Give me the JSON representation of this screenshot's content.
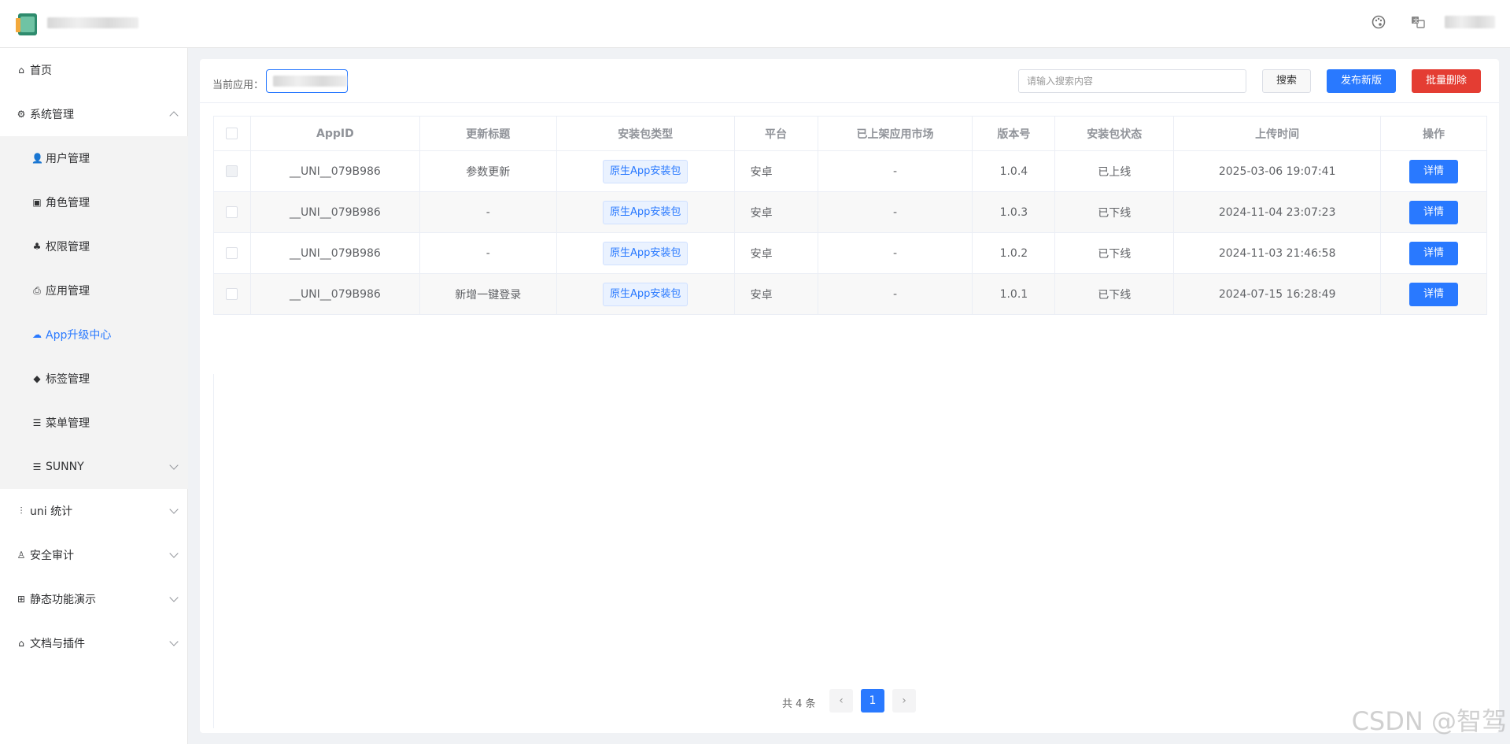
{
  "header": {
    "app_name": "",
    "user_name": "",
    "icons": [
      "palette-icon",
      "translate-icon"
    ]
  },
  "sidebar": {
    "items": [
      {
        "label": "首页",
        "icon": "home-icon"
      },
      {
        "label": "系统管理",
        "icon": "gear-icon",
        "expanded": true
      },
      {
        "label": "用户管理",
        "icon": "user-icon"
      },
      {
        "label": "角色管理",
        "icon": "role-icon"
      },
      {
        "label": "权限管理",
        "icon": "permission-icon"
      },
      {
        "label": "应用管理",
        "icon": "app-icon"
      },
      {
        "label": "App升级中心",
        "icon": "cloud-upload-icon",
        "active": true
      },
      {
        "label": "标签管理",
        "icon": "tag-icon"
      },
      {
        "label": "菜单管理",
        "icon": "list-icon"
      },
      {
        "label": "SUNNY",
        "icon": "list-icon"
      },
      {
        "label": "uni 统计",
        "icon": "stats-icon"
      },
      {
        "label": "安全审计",
        "icon": "audit-icon"
      },
      {
        "label": "静态功能演示",
        "icon": "grid-icon"
      },
      {
        "label": "文档与插件",
        "icon": "plugin-icon"
      }
    ]
  },
  "toolbar": {
    "current_app_label": "当前应用：",
    "current_app_value": "",
    "search_placeholder": "请输入搜索内容",
    "search_button": "搜索",
    "publish_button": "发布新版",
    "batch_delete_button": "批量删除"
  },
  "table": {
    "columns": [
      "AppID",
      "更新标题",
      "安装包类型",
      "平台",
      "已上架应用市场",
      "版本号",
      "安装包状态",
      "上传时间",
      "操作"
    ],
    "rows": [
      {
        "appid": "__UNI__079B986",
        "title": "参数更新",
        "type": "原生App安装包",
        "platform": "安卓",
        "market": "-",
        "version": "1.0.4",
        "status": "已上线",
        "time": "2025-03-06 19:07:41",
        "action": "详情"
      },
      {
        "appid": "__UNI__079B986",
        "title": "-",
        "type": "原生App安装包",
        "platform": "安卓",
        "market": "-",
        "version": "1.0.3",
        "status": "已下线",
        "time": "2024-11-04 23:07:23",
        "action": "详情"
      },
      {
        "appid": "__UNI__079B986",
        "title": "-",
        "type": "原生App安装包",
        "platform": "安卓",
        "market": "-",
        "version": "1.0.2",
        "status": "已下线",
        "time": "2024-11-03 21:46:58",
        "action": "详情"
      },
      {
        "appid": "__UNI__079B986",
        "title": "新增一键登录",
        "type": "原生App安装包",
        "platform": "安卓",
        "market": "-",
        "version": "1.0.1",
        "status": "已下线",
        "time": "2024-07-15 16:28:49",
        "action": "详情"
      }
    ]
  },
  "pagination": {
    "total_text": "共 4 条",
    "current_page": "1",
    "prev": "‹",
    "next": "›"
  },
  "watermark": "CSDN @智驾",
  "colors": {
    "primary": "#2979ff",
    "danger": "#e43d33"
  }
}
